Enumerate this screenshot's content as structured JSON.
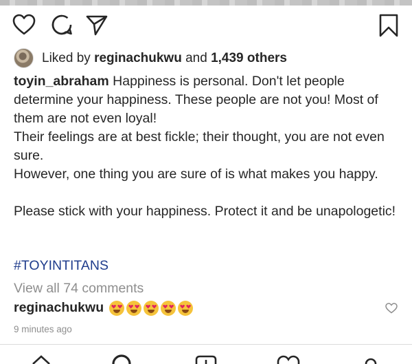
{
  "post": {
    "liked_by_prefix": "Liked by",
    "liked_by_user": "reginachukwu",
    "liked_by_and": "and",
    "liked_by_others": "1,439 others",
    "caption_user": "toyin_abraham",
    "caption_text": "Happiness is personal. Don't let people determine your happiness. These people are not you! Most of them are not even loyal!\nTheir feelings are at best fickle; their thought, you are not even sure.\nHowever, one thing you are sure of is what makes you happy.\n\nPlease stick with your happiness. Protect it and be unapologetic!",
    "hashtag": "#TOYINTITANS",
    "view_all_comments": "View all 74 comments",
    "comment_user": "reginachukwu",
    "comment_emoji_count": 5,
    "timestamp": "9 minutes ago"
  },
  "icons": {
    "like": "heart-icon",
    "comment": "comment-bubble-icon",
    "share": "send-icon",
    "save": "bookmark-icon",
    "nav": [
      "home-icon",
      "search-icon",
      "add-post-icon",
      "activity-heart-icon",
      "profile-icon"
    ]
  },
  "colors": {
    "text": "#262626",
    "muted": "#8e8e8e",
    "hashtag": "#1f3c8c",
    "emoji_face": "#f5c33b",
    "emoji_eyes": "#e0245e"
  }
}
